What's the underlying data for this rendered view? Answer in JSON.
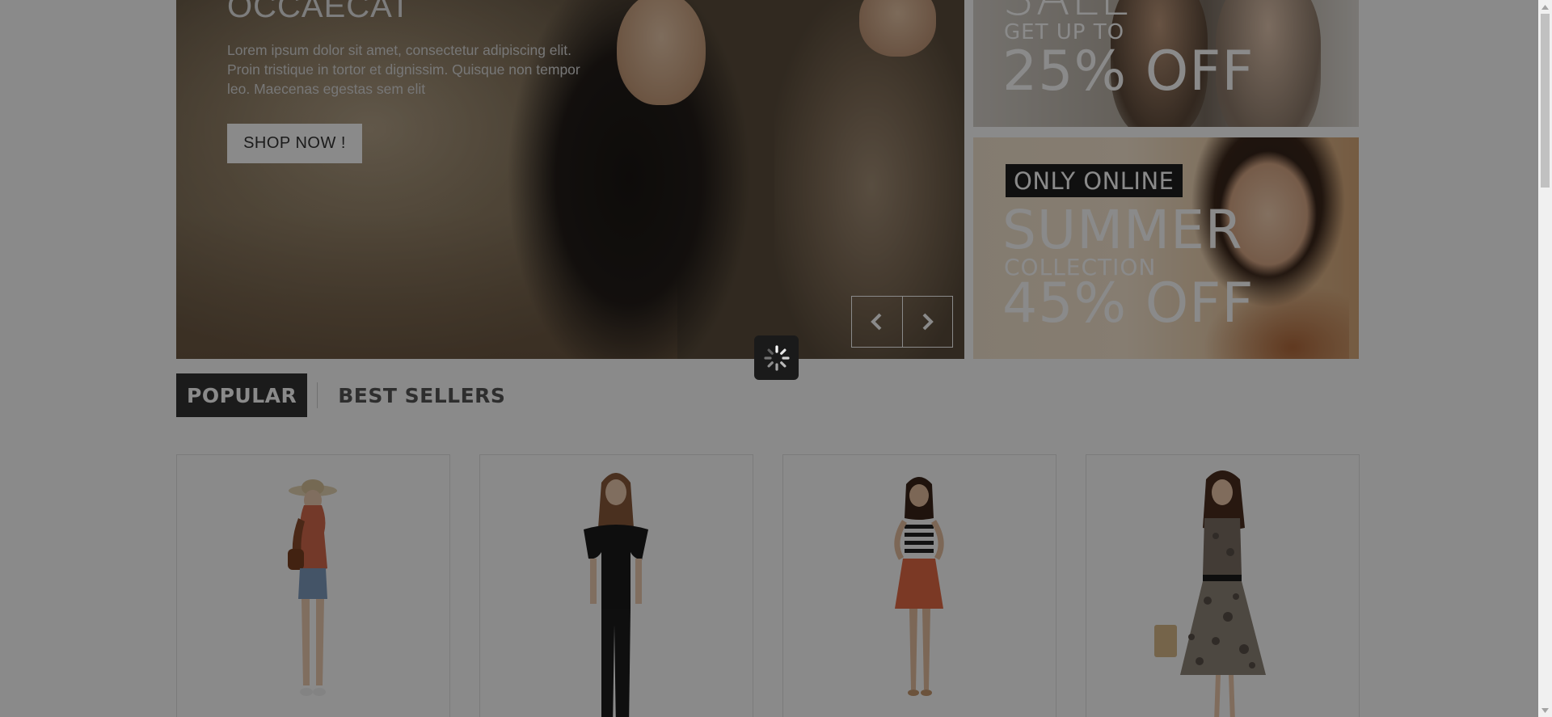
{
  "hero": {
    "title": "OCCAECAT",
    "text": "Lorem ipsum dolor sit amet, consectetur adipiscing elit. Proin tristique in tortor et dignissim. Quisque non tempor leo. Maecenas egestas sem elit",
    "button_label": "SHOP NOW !",
    "nav": {
      "prev_icon": "chevron-left-icon",
      "next_icon": "chevron-right-icon"
    }
  },
  "promo_top": {
    "headline": "SALE",
    "subline": "GET UP TO",
    "discount": "25% OFF"
  },
  "promo_bottom": {
    "badge": "ONLY ONLINE",
    "headline": "SUMMER",
    "subline": "COLLECTION",
    "discount": "45% OFF"
  },
  "tabs": [
    {
      "label": "POPULAR",
      "active": true
    },
    {
      "label": "BEST SELLERS",
      "active": false
    }
  ],
  "products": [
    {
      "image": "woman-red-top-denim-shorts"
    },
    {
      "image": "woman-black-top-black-pants"
    },
    {
      "image": "woman-striped-top-orange-skirt"
    },
    {
      "image": "woman-patterned-dress"
    }
  ],
  "loader": {
    "icon": "spinner-icon"
  },
  "colors": {
    "overlay": "#000000",
    "tab_active_bg": "#333333",
    "badge_bg": "#1e1e1e"
  }
}
